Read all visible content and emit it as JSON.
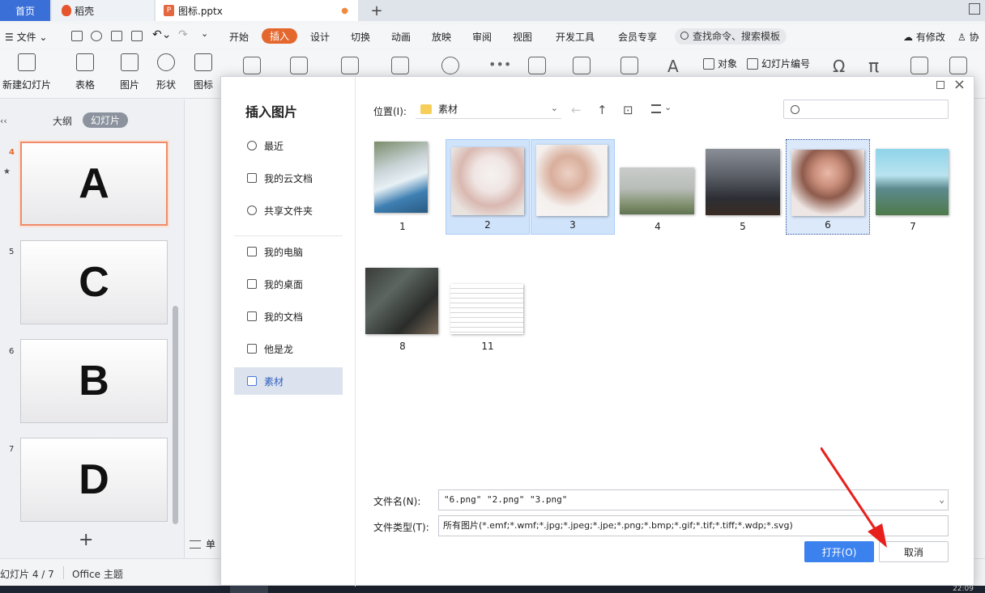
{
  "tabs": {
    "home": "首页",
    "daoke": "稻壳",
    "file": "图标.pptx"
  },
  "menu": {
    "file": "文件",
    "items": [
      "开始",
      "插入",
      "设计",
      "切换",
      "动画",
      "放映",
      "审阅",
      "视图",
      "开发工具",
      "会员专享"
    ],
    "active": "插入",
    "search": "查找命令、搜索模板",
    "changes": "有修改",
    "collab": "协"
  },
  "ribbon": {
    "new_slide": "新建幻灯片",
    "table": "表格",
    "picture": "图片",
    "shape": "形状",
    "icon": "图标",
    "object": "对象",
    "slide_number": "幻灯片编号"
  },
  "left_panel": {
    "outline_tab": "大纲",
    "slides_tab": "幻灯片",
    "slides": [
      {
        "num": "4",
        "letter": "A"
      },
      {
        "num": "5",
        "letter": "C"
      },
      {
        "num": "6",
        "letter": "B"
      },
      {
        "num": "7",
        "letter": "D"
      }
    ],
    "notes": "单"
  },
  "status": {
    "slide_info": "幻灯片 4 / 7",
    "theme": "Office 主题"
  },
  "taskbar": {
    "clock": "22:09"
  },
  "dialog": {
    "title": "插入图片",
    "sidebar": [
      "最近",
      "我的云文档",
      "共享文件夹",
      "我的电脑",
      "我的桌面",
      "我的文档",
      "他是龙",
      "素材"
    ],
    "active_sidebar": "素材",
    "location_label": "位置(I):",
    "location_value": "素材",
    "files": [
      {
        "label": "1",
        "selected": false
      },
      {
        "label": "2",
        "selected": true
      },
      {
        "label": "3",
        "selected": true
      },
      {
        "label": "4",
        "selected": false
      },
      {
        "label": "5",
        "selected": false
      },
      {
        "label": "6",
        "selected": true
      },
      {
        "label": "7",
        "selected": false
      },
      {
        "label": "8",
        "selected": false
      },
      {
        "label": "11",
        "selected": false
      }
    ],
    "filename_label": "文件名(N):",
    "filename_value": "\"6.png\" \"2.png\" \"3.png\"",
    "filetype_label": "文件类型(T):",
    "filetype_value": "所有图片(*.emf;*.wmf;*.jpg;*.jpeg;*.jpe;*.png;*.bmp;*.gif;*.tif;*.tiff;*.wdp;*.svg)",
    "open_button": "打开(O)",
    "cancel_button": "取消"
  },
  "colors": {
    "accent": "#e4682e",
    "primary": "#3b82ef",
    "arrow": "#e8201c"
  }
}
